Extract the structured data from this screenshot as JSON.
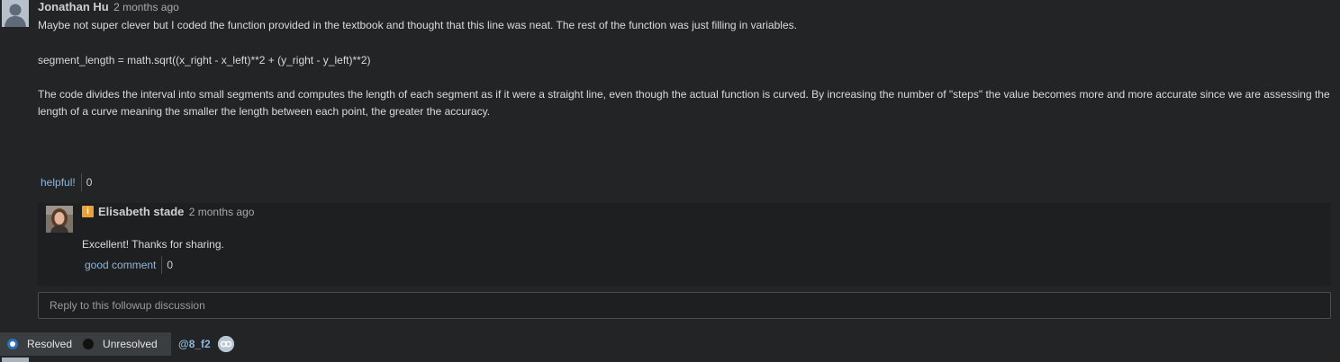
{
  "post": {
    "author": "Jonathan Hu",
    "time": "2 months ago",
    "paragraphs": [
      "Maybe not super clever but I coded the function provided in the textbook and thought that this line was neat. The rest of the function was just filling in variables.",
      "segment_length = math.sqrt((x_right - x_left)**2 + (y_right - y_left)**2)",
      "The code divides the interval into small segments and computes the length of each segment as if it were a straight line, even though the actual function is curved. By increasing the number of \"steps\" the value becomes more and more accurate since we are assessing the length of a curve meaning the smaller the length between each point, the greater the accuracy."
    ],
    "helpful_label": "helpful!",
    "helpful_count": "0"
  },
  "reply": {
    "author": "Elisabeth stade",
    "time": "2 months ago",
    "badge": "i",
    "text": "Excellent! Thanks for sharing.",
    "good_label": "good comment",
    "good_count": "0"
  },
  "followup": {
    "placeholder": "Reply to this followup discussion"
  },
  "status": {
    "resolved_label": "Resolved",
    "unresolved_label": "Unresolved",
    "selected": "Resolved"
  },
  "post_id": "@8_f2",
  "icons": {
    "post_avatar": "default-user-avatar-icon",
    "reply_avatar": "user-photo-avatar",
    "link": "link-icon"
  },
  "colors": {
    "background": "#222425",
    "link": "#8fb6dc",
    "instructor_badge": "#e8a23a",
    "radio_selected": "#2f6fb8"
  }
}
